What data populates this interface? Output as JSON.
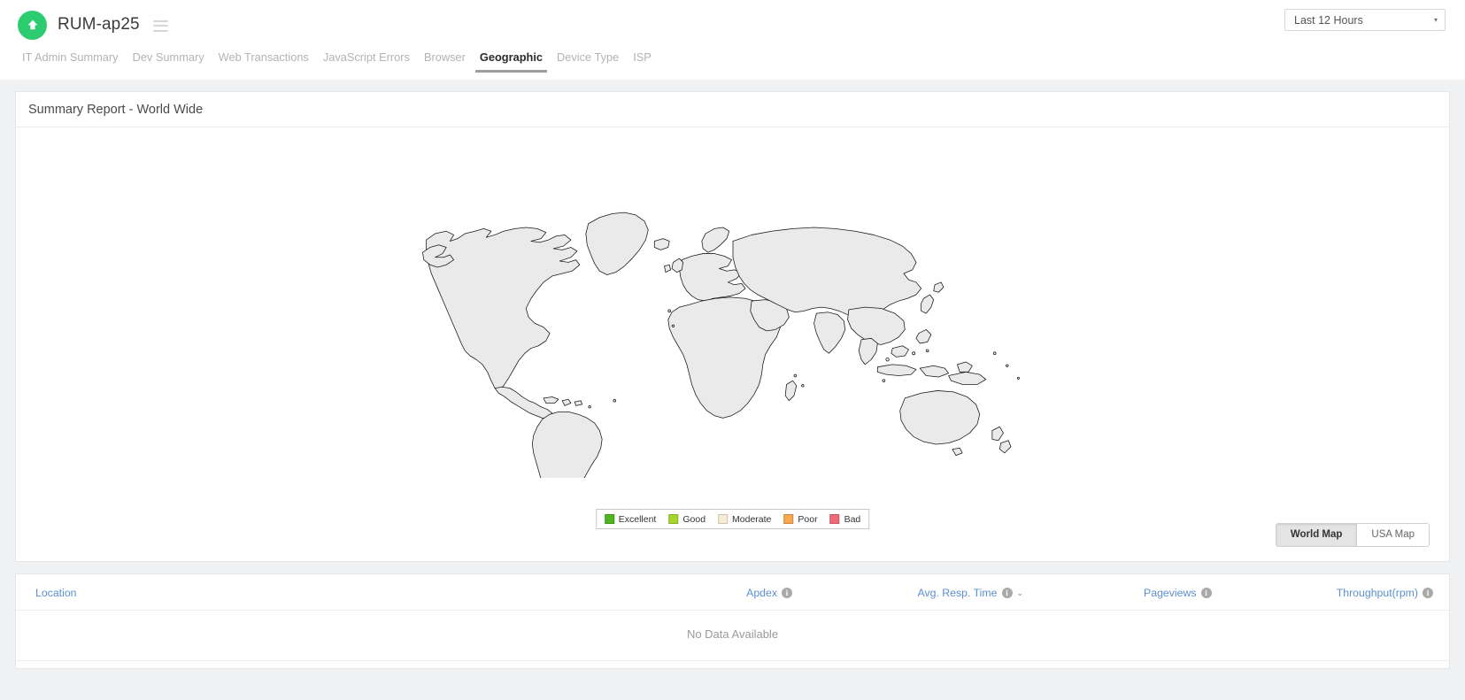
{
  "header": {
    "brand_title": "RUM-ap25",
    "logo_icon": "green-circle-up-arrow-icon",
    "menu_icon": "hamburger-menu-icon",
    "time_range": "Last 12 Hours",
    "time_range_caret": "▾"
  },
  "tabs": [
    {
      "label": "IT Admin Summary",
      "active": false
    },
    {
      "label": "Dev Summary",
      "active": false
    },
    {
      "label": "Web Transactions",
      "active": false
    },
    {
      "label": "JavaScript Errors",
      "active": false
    },
    {
      "label": "Browser",
      "active": false
    },
    {
      "label": "Geographic",
      "active": true
    },
    {
      "label": "Device Type",
      "active": false
    },
    {
      "label": "ISP",
      "active": false
    }
  ],
  "map_card": {
    "title": "Summary Report - World Wide",
    "legend": [
      {
        "label": "Excellent",
        "color": "#4CB520"
      },
      {
        "label": "Good",
        "color": "#A5D629"
      },
      {
        "label": "Moderate",
        "color": "#F6EDD2"
      },
      {
        "label": "Poor",
        "color": "#F7A74E"
      },
      {
        "label": "Bad",
        "color": "#EF6B78"
      }
    ],
    "toggle": [
      {
        "label": "World Map",
        "active": true
      },
      {
        "label": "USA Map",
        "active": false
      }
    ],
    "map_fill": "#EAEAEA",
    "map_stroke": "#1a1a1a"
  },
  "table": {
    "columns": [
      {
        "label": "Location",
        "info": false,
        "sort": false
      },
      {
        "label": "Apdex",
        "info": true,
        "sort": false
      },
      {
        "label": "Avg. Resp. Time",
        "info": true,
        "sort": true
      },
      {
        "label": "Pageviews",
        "info": true,
        "sort": false
      },
      {
        "label": "Throughput(rpm)",
        "info": true,
        "sort": false
      }
    ],
    "info_glyph": "i",
    "sort_glyph": "⌄",
    "empty_message": "No Data Available",
    "rows": []
  },
  "colors": {
    "accent_green": "#2ecc71",
    "link_blue": "#5b8fd0",
    "page_bg": "#f0f1f2",
    "card_bg": "#ffffff",
    "muted_text": "#9a9a9a"
  }
}
